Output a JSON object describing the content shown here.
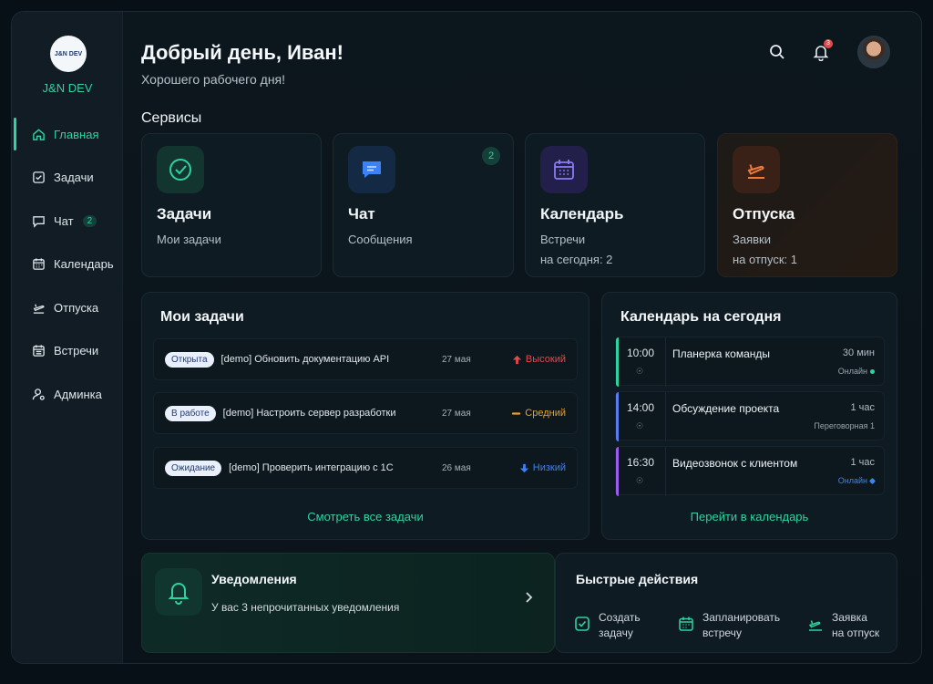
{
  "brand": {
    "logo_text": "J&N DEV",
    "name": "J&N DEV"
  },
  "sidebar": {
    "items": [
      {
        "label": "Главная",
        "icon": "home-icon",
        "active": true
      },
      {
        "label": "Задачи",
        "icon": "checkbox-icon"
      },
      {
        "label": "Чат",
        "icon": "chat-icon",
        "badge": "2"
      },
      {
        "label": "Календарь",
        "icon": "calendar-icon"
      },
      {
        "label": "Отпуска",
        "icon": "plane-icon"
      },
      {
        "label": "Встречи",
        "icon": "calendar-grid-icon"
      },
      {
        "label": "Админка",
        "icon": "admin-user-icon"
      }
    ]
  },
  "header": {
    "greeting": "Добрый день, Иван!",
    "subtitle": "Хорошего рабочего дня!",
    "notification_count": "3"
  },
  "services": {
    "title": "Сервисы",
    "cards": [
      {
        "title": "Задачи",
        "subtitle": "Мои задачи",
        "icon": "check-circle-icon",
        "accent": "#2ed3a2"
      },
      {
        "title": "Чат",
        "subtitle": "Сообщения",
        "icon": "chat-bubble-icon",
        "badge": "2",
        "accent": "#3b82f6"
      },
      {
        "title": "Календарь",
        "subtitle": "Встречи",
        "subtitle2": "на сегодня: 2",
        "icon": "calendar-icon",
        "accent": "#7c6cf0"
      },
      {
        "title": "Отпуска",
        "subtitle": "Заявки",
        "subtitle2": "на отпуск: 1",
        "icon": "plane-icon",
        "accent": "#f07a3a"
      }
    ]
  },
  "tasks": {
    "title": "Мои задачи",
    "rows": [
      {
        "status": "Открыта",
        "title": "[demo] Обновить документацию API",
        "date": "27 мая",
        "priority": "Высокий",
        "priority_color": "#e5484d"
      },
      {
        "status": "В работе",
        "title": "[demo] Настроить сервер разработки",
        "date": "27 мая",
        "priority": "Средний",
        "priority_color": "#f0a020"
      },
      {
        "status": "Ожидание",
        "title": "[demo] Проверить интеграцию с 1С",
        "date": "26 мая",
        "priority": "Низкий",
        "priority_color": "#3b82f6"
      }
    ],
    "link": "Смотреть все задачи"
  },
  "calendar": {
    "title": "Календарь на сегодня",
    "events": [
      {
        "time": "10:00",
        "title": "Планерка команды",
        "duration": "30 мин",
        "location": "Онлайн",
        "color": "#2ed3a2"
      },
      {
        "time": "14:00",
        "title": "Обсуждение проекта",
        "duration": "1 час",
        "location": "Переговорная 1",
        "color": "#5b7cf0"
      },
      {
        "time": "16:30",
        "title": "Видеозвонок с клиентом",
        "duration": "1 час",
        "location": "Онлайн",
        "color": "#9b5cf0"
      }
    ],
    "link": "Перейти в календарь"
  },
  "notifications": {
    "title": "Уведомления",
    "text": "У вас 3 непрочитанных уведомления"
  },
  "quick_actions": {
    "title": "Быстрые действия",
    "items": [
      {
        "line1": "Создать",
        "line2": "задачу",
        "icon": "check-square-icon"
      },
      {
        "line1": "Запланировать",
        "line2": "встречу",
        "icon": "calendar-icon"
      },
      {
        "line1": "Заявка",
        "line2": "на отпуск",
        "icon": "plane-icon"
      }
    ]
  }
}
